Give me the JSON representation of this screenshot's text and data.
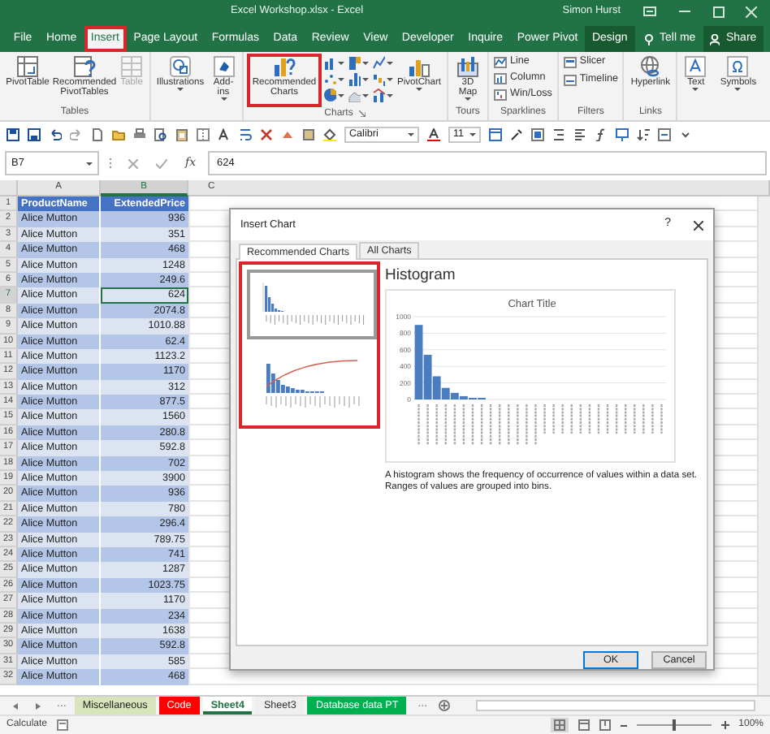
{
  "title_bar": {
    "title": "Excel Workshop.xlsx - Excel",
    "user": "Simon Hurst"
  },
  "tabs": [
    {
      "label": "File",
      "selected": false,
      "highlighted": false,
      "kind": "tab"
    },
    {
      "label": "Home",
      "selected": false,
      "highlighted": false,
      "kind": "tab"
    },
    {
      "label": "Insert",
      "selected": true,
      "highlighted": true,
      "kind": "tab"
    },
    {
      "label": "Page Layout",
      "selected": false,
      "highlighted": false,
      "kind": "tab"
    },
    {
      "label": "Formulas",
      "selected": false,
      "highlighted": false,
      "kind": "tab"
    },
    {
      "label": "Data",
      "selected": false,
      "highlighted": false,
      "kind": "tab"
    },
    {
      "label": "Review",
      "selected": false,
      "highlighted": false,
      "kind": "tab"
    },
    {
      "label": "View",
      "selected": false,
      "highlighted": false,
      "kind": "tab"
    },
    {
      "label": "Developer",
      "selected": false,
      "highlighted": false,
      "kind": "tab"
    },
    {
      "label": "Inquire",
      "selected": false,
      "highlighted": false,
      "kind": "tab"
    },
    {
      "label": "Power Pivot",
      "selected": false,
      "highlighted": false,
      "kind": "tab"
    },
    {
      "label": "Design",
      "selected": false,
      "highlighted": false,
      "kind": "contextual"
    }
  ],
  "tell_me": "Tell me",
  "share": "Share",
  "ribbon": {
    "groups": [
      {
        "label": "Tables",
        "buttons": [
          {
            "label": "PivotTable",
            "disabled": false
          },
          {
            "label": "Recommended PivotTables",
            "disabled": false
          },
          {
            "label": "Table",
            "disabled": true
          }
        ]
      },
      {
        "buttons": [
          {
            "label": "Illustrations"
          },
          {
            "label": "Add-ins"
          }
        ]
      },
      {
        "label": "Charts",
        "buttons": [
          {
            "label": "Recommended Charts",
            "highlighted": true
          },
          {
            "label": "PivotChart",
            "highlighted": false
          }
        ]
      },
      {
        "label": "Tours",
        "buttons": [
          {
            "label": "3D Map"
          }
        ]
      },
      {
        "label": "Sparklines",
        "buttons": [
          {
            "label": "Line"
          },
          {
            "label": "Column"
          },
          {
            "label": "Win/Loss"
          }
        ]
      },
      {
        "label": "Filters",
        "buttons": [
          {
            "label": "Slicer"
          },
          {
            "label": "Timeline"
          }
        ]
      },
      {
        "label": "Links",
        "buttons": [
          {
            "label": "Hyperlink"
          }
        ]
      },
      {
        "buttons": [
          {
            "label": "Text"
          },
          {
            "label": "Symbols"
          }
        ]
      }
    ]
  },
  "quick_access": {
    "font_name": "Calibri",
    "font_size": "11"
  },
  "formula_bar": {
    "name_box": "B7",
    "fx": "fx",
    "value": "624"
  },
  "sheet": {
    "columns": [
      "A",
      "B",
      "C"
    ],
    "header": {
      "n": "1",
      "cells": [
        "ProductName",
        "ExtendedPrice"
      ]
    },
    "rows": [
      {
        "n": "2",
        "product": "Alice Mutton",
        "price": "936",
        "selected": false
      },
      {
        "n": "3",
        "product": "Alice Mutton",
        "price": "351",
        "selected": false
      },
      {
        "n": "4",
        "product": "Alice Mutton",
        "price": "468",
        "selected": false
      },
      {
        "n": "5",
        "product": "Alice Mutton",
        "price": "1248",
        "selected": false
      },
      {
        "n": "6",
        "product": "Alice Mutton",
        "price": "249.6",
        "selected": false
      },
      {
        "n": "7",
        "product": "Alice Mutton",
        "price": "624",
        "selected": true
      },
      {
        "n": "8",
        "product": "Alice Mutton",
        "price": "2074.8",
        "selected": false
      },
      {
        "n": "9",
        "product": "Alice Mutton",
        "price": "1010.88",
        "selected": false
      },
      {
        "n": "10",
        "product": "Alice Mutton",
        "price": "62.4",
        "selected": false
      },
      {
        "n": "11",
        "product": "Alice Mutton",
        "price": "1123.2",
        "selected": false
      },
      {
        "n": "12",
        "product": "Alice Mutton",
        "price": "1170",
        "selected": false
      },
      {
        "n": "13",
        "product": "Alice Mutton",
        "price": "312",
        "selected": false
      },
      {
        "n": "14",
        "product": "Alice Mutton",
        "price": "877.5",
        "selected": false
      },
      {
        "n": "15",
        "product": "Alice Mutton",
        "price": "1560",
        "selected": false
      },
      {
        "n": "16",
        "product": "Alice Mutton",
        "price": "280.8",
        "selected": false
      },
      {
        "n": "17",
        "product": "Alice Mutton",
        "price": "592.8",
        "selected": false
      },
      {
        "n": "18",
        "product": "Alice Mutton",
        "price": "702",
        "selected": false
      },
      {
        "n": "19",
        "product": "Alice Mutton",
        "price": "3900",
        "selected": false
      },
      {
        "n": "20",
        "product": "Alice Mutton",
        "price": "936",
        "selected": false
      },
      {
        "n": "21",
        "product": "Alice Mutton",
        "price": "780",
        "selected": false
      },
      {
        "n": "22",
        "product": "Alice Mutton",
        "price": "296.4",
        "selected": false
      },
      {
        "n": "23",
        "product": "Alice Mutton",
        "price": "789.75",
        "selected": false
      },
      {
        "n": "24",
        "product": "Alice Mutton",
        "price": "741",
        "selected": false
      },
      {
        "n": "25",
        "product": "Alice Mutton",
        "price": "1287",
        "selected": false
      },
      {
        "n": "26",
        "product": "Alice Mutton",
        "price": "1023.75",
        "selected": false
      },
      {
        "n": "27",
        "product": "Alice Mutton",
        "price": "1170",
        "selected": false
      },
      {
        "n": "28",
        "product": "Alice Mutton",
        "price": "234",
        "selected": false
      },
      {
        "n": "29",
        "product": "Alice Mutton",
        "price": "1638",
        "selected": false
      },
      {
        "n": "30",
        "product": "Alice Mutton",
        "price": "592.8",
        "selected": false
      },
      {
        "n": "31",
        "product": "Alice Mutton",
        "price": "585",
        "selected": false
      },
      {
        "n": "32",
        "product": "Alice Mutton",
        "price": "468",
        "selected": false
      }
    ]
  },
  "dialog": {
    "title": "Insert Chart",
    "help": "?",
    "tabs": [
      {
        "label": "Recommended Charts",
        "selected": true
      },
      {
        "label": "All Charts",
        "selected": false
      }
    ],
    "list_highlighted": true,
    "thumbnails": [
      {
        "kind": "histogram",
        "selected": true
      },
      {
        "kind": "pareto",
        "selected": false
      }
    ],
    "heading": "Histogram",
    "chart_data": {
      "type": "bar",
      "title": "Chart Title",
      "values": [
        900,
        540,
        280,
        140,
        80,
        40,
        20,
        20,
        0,
        0,
        0,
        0,
        0,
        0,
        0,
        0,
        0,
        0,
        0,
        0,
        0,
        0,
        0,
        0,
        0,
        0,
        0,
        0
      ],
      "grid": true,
      "yticks": [
        0,
        200,
        400,
        600,
        800,
        1000
      ],
      "ylim": [
        0,
        1000
      ]
    },
    "description": "A histogram shows the frequency of occurrence of values within a data set. Ranges of values are grouped into bins.",
    "buttons": [
      {
        "label": "OK",
        "default": true
      },
      {
        "label": "Cancel",
        "default": false
      }
    ]
  },
  "sheet_tabs": {
    "more_left": "...",
    "more_right": "...",
    "tabs": [
      {
        "label": "Miscellaneous",
        "selected": false,
        "color": "#d8e4bc"
      },
      {
        "label": "Code",
        "selected": false,
        "color": "#ff0000"
      },
      {
        "label": "Sheet4",
        "selected": true
      },
      {
        "label": "Sheet3",
        "selected": false
      },
      {
        "label": "Database data PT",
        "selected": false,
        "color": "#00b050"
      }
    ]
  },
  "status_bar": {
    "mode": "Calculate",
    "zoom": "100%",
    "zoom_slider": {
      "level": 0.5
    }
  }
}
